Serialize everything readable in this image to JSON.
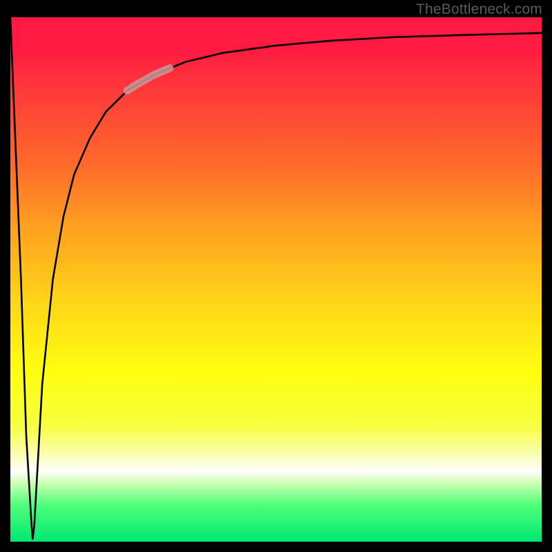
{
  "attribution": "TheBottleneck.com",
  "chart_data": {
    "type": "line",
    "title": "",
    "xlabel": "",
    "ylabel": "",
    "xlim": [
      0,
      100
    ],
    "ylim": [
      0,
      100
    ],
    "series": [
      {
        "name": "curve",
        "x": [
          0,
          2,
          3,
          4,
          4.2,
          4.5,
          5,
          6,
          8,
          10,
          12,
          15,
          18,
          22,
          27,
          33,
          40,
          50,
          60,
          72,
          85,
          100
        ],
        "values": [
          100,
          50,
          20,
          3,
          0.5,
          3,
          12,
          30,
          50,
          62,
          70,
          77,
          82,
          86,
          89,
          91.5,
          93.2,
          94.6,
          95.5,
          96.2,
          96.6,
          97
        ]
      },
      {
        "name": "highlight-segment",
        "x": [
          22,
          24,
          27,
          30
        ],
        "values": [
          86,
          87.3,
          89,
          90.3
        ]
      }
    ],
    "colors": {
      "curve": "#000000",
      "highlight": "#c99a9a"
    },
    "gradient_stops": [
      {
        "pos": 0,
        "color": "#ff1a42"
      },
      {
        "pos": 0.5,
        "color": "#ffe010"
      },
      {
        "pos": 0.86,
        "color": "#ffffff"
      },
      {
        "pos": 1.0,
        "color": "#00e872"
      }
    ]
  }
}
